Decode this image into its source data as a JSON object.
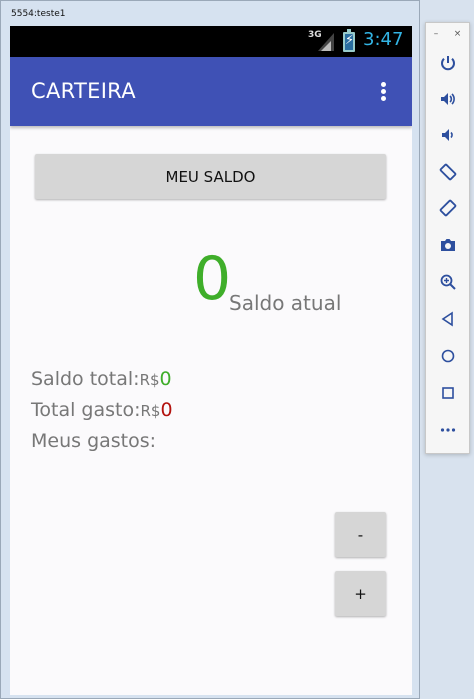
{
  "window": {
    "title": "5554:teste1"
  },
  "statusbar": {
    "network": "3G",
    "time": "3:47"
  },
  "appbar": {
    "title": "CARTEIRA"
  },
  "main": {
    "saldo_button": "MEU SALDO",
    "balance_value": "0",
    "balance_label": "Saldo atual",
    "total_label": "Saldo total:",
    "total_currency": "R$",
    "total_value": "0",
    "gasto_label": "Total gasto:",
    "gasto_currency": "R$",
    "gasto_value": "0",
    "meus_gastos_label": "Meus gastos:",
    "minus_button": "-",
    "plus_button": "+"
  },
  "side_panel": {
    "minimize_symbol": "–",
    "close_symbol": "×",
    "buttons": [
      "power-icon",
      "volume-up-icon",
      "volume-down-icon",
      "rotate-left-icon",
      "rotate-right-icon",
      "camera-icon",
      "zoom-icon",
      "back-icon",
      "home-icon",
      "overview-icon",
      "more-icon"
    ]
  },
  "colors": {
    "appbar": "#3f51b5",
    "positive": "#3fae2a",
    "negative": "#b3120e",
    "clock": "#33b5e5"
  }
}
